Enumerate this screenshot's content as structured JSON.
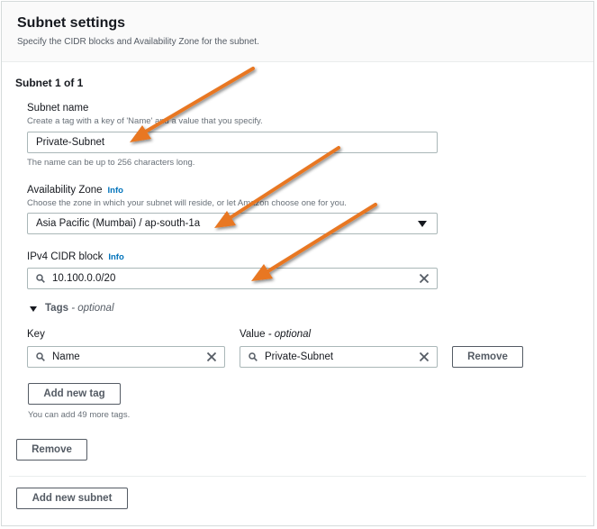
{
  "header": {
    "title": "Subnet settings",
    "description": "Specify the CIDR blocks and Availability Zone for the subnet."
  },
  "subnet": {
    "counter": "Subnet 1 of 1",
    "name": {
      "label": "Subnet name",
      "description": "Create a tag with a key of 'Name' and a value that you specify.",
      "value": "Private-Subnet",
      "hint": "The name can be up to 256 characters long."
    },
    "az": {
      "label": "Availability Zone",
      "info": "Info",
      "description": "Choose the zone in which your subnet will reside, or let Amazon choose one for you.",
      "value": "Asia Pacific (Mumbai) / ap-south-1a"
    },
    "cidr": {
      "label": "IPv4 CIDR block",
      "info": "Info",
      "value": "10.100.0.0/20"
    },
    "tags": {
      "heading": "Tags",
      "heading_suffix": "- optional",
      "key_label": "Key",
      "value_label": "Value",
      "value_label_suffix": "- optional",
      "rows": [
        {
          "key": "Name",
          "value": "Private-Subnet",
          "remove_label": "Remove"
        }
      ],
      "add_label": "Add new tag",
      "hint": "You can add 49 more tags."
    },
    "remove_label": "Remove"
  },
  "add_subnet_label": "Add new subnet",
  "colors": {
    "annotation_arrow": "#e87722",
    "link": "#0073bb",
    "border": "#aab7b8"
  },
  "icons": [
    "search-icon",
    "clear-icon",
    "caret-down-icon",
    "expand-triangle-icon",
    "annotation-arrow"
  ]
}
